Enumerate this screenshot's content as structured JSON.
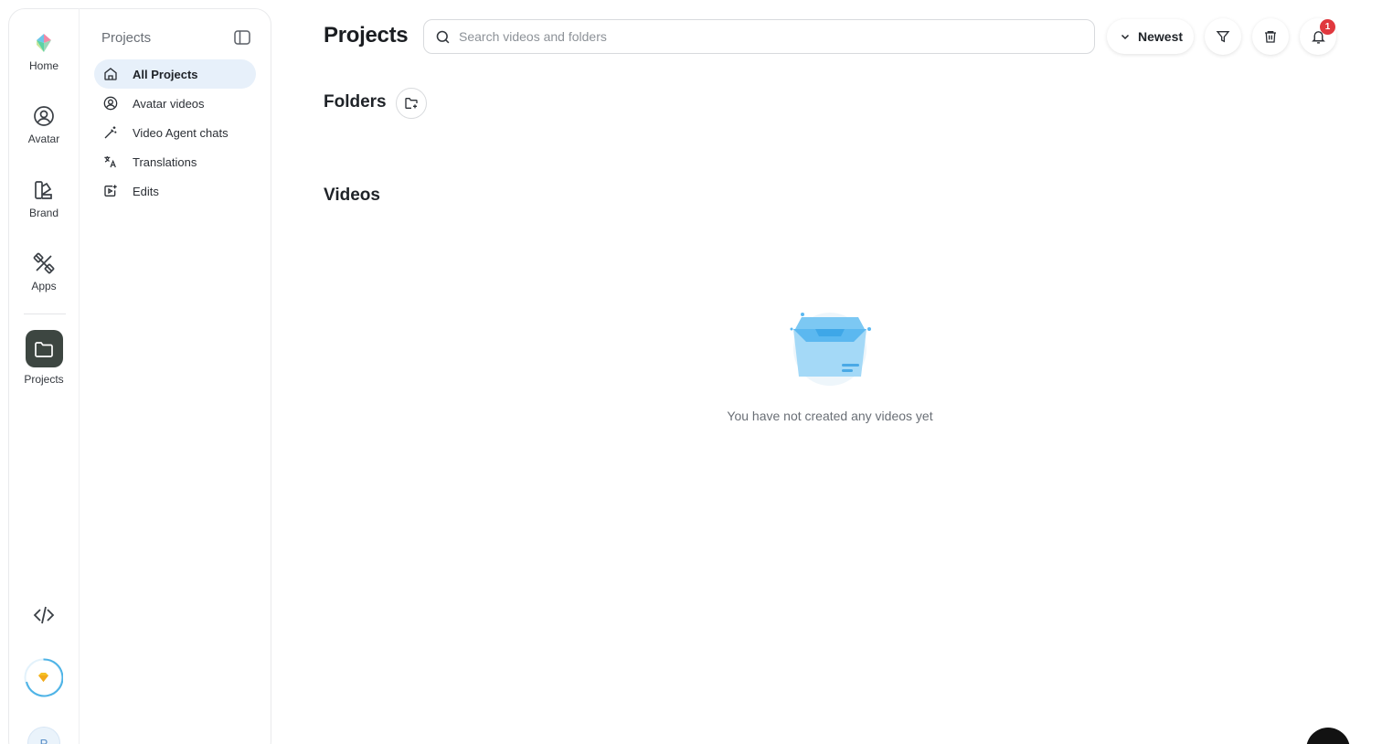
{
  "rail": {
    "items": [
      {
        "label": "Home",
        "icon": "logo-icon"
      },
      {
        "label": "Avatar",
        "icon": "avatar-icon"
      },
      {
        "label": "Brand",
        "icon": "brand-icon"
      },
      {
        "label": "Apps",
        "icon": "apps-icon"
      },
      {
        "label": "Projects",
        "icon": "folder-icon"
      }
    ],
    "avatar_initial": "P",
    "accent": "#3d4641"
  },
  "sidebar": {
    "title": "Projects",
    "items": [
      {
        "label": "All Projects",
        "icon": "home-icon",
        "active": true
      },
      {
        "label": "Avatar videos",
        "icon": "avatar-icon",
        "active": false
      },
      {
        "label": "Video Agent chats",
        "icon": "magic-wand-icon",
        "active": false
      },
      {
        "label": "Translations",
        "icon": "translate-icon",
        "active": false
      },
      {
        "label": "Edits",
        "icon": "video-edit-icon",
        "active": false
      }
    ]
  },
  "header": {
    "title": "Projects",
    "search_placeholder": "Search videos and folders",
    "sort_label": "Newest",
    "notification_count": "1"
  },
  "folders": {
    "title": "Folders"
  },
  "videos": {
    "title": "Videos",
    "empty_message": "You have not created any videos yet"
  },
  "colors": {
    "active_bg": "#e7f0fa",
    "badge": "#e0383e",
    "illustration": "#5bb8f0"
  }
}
